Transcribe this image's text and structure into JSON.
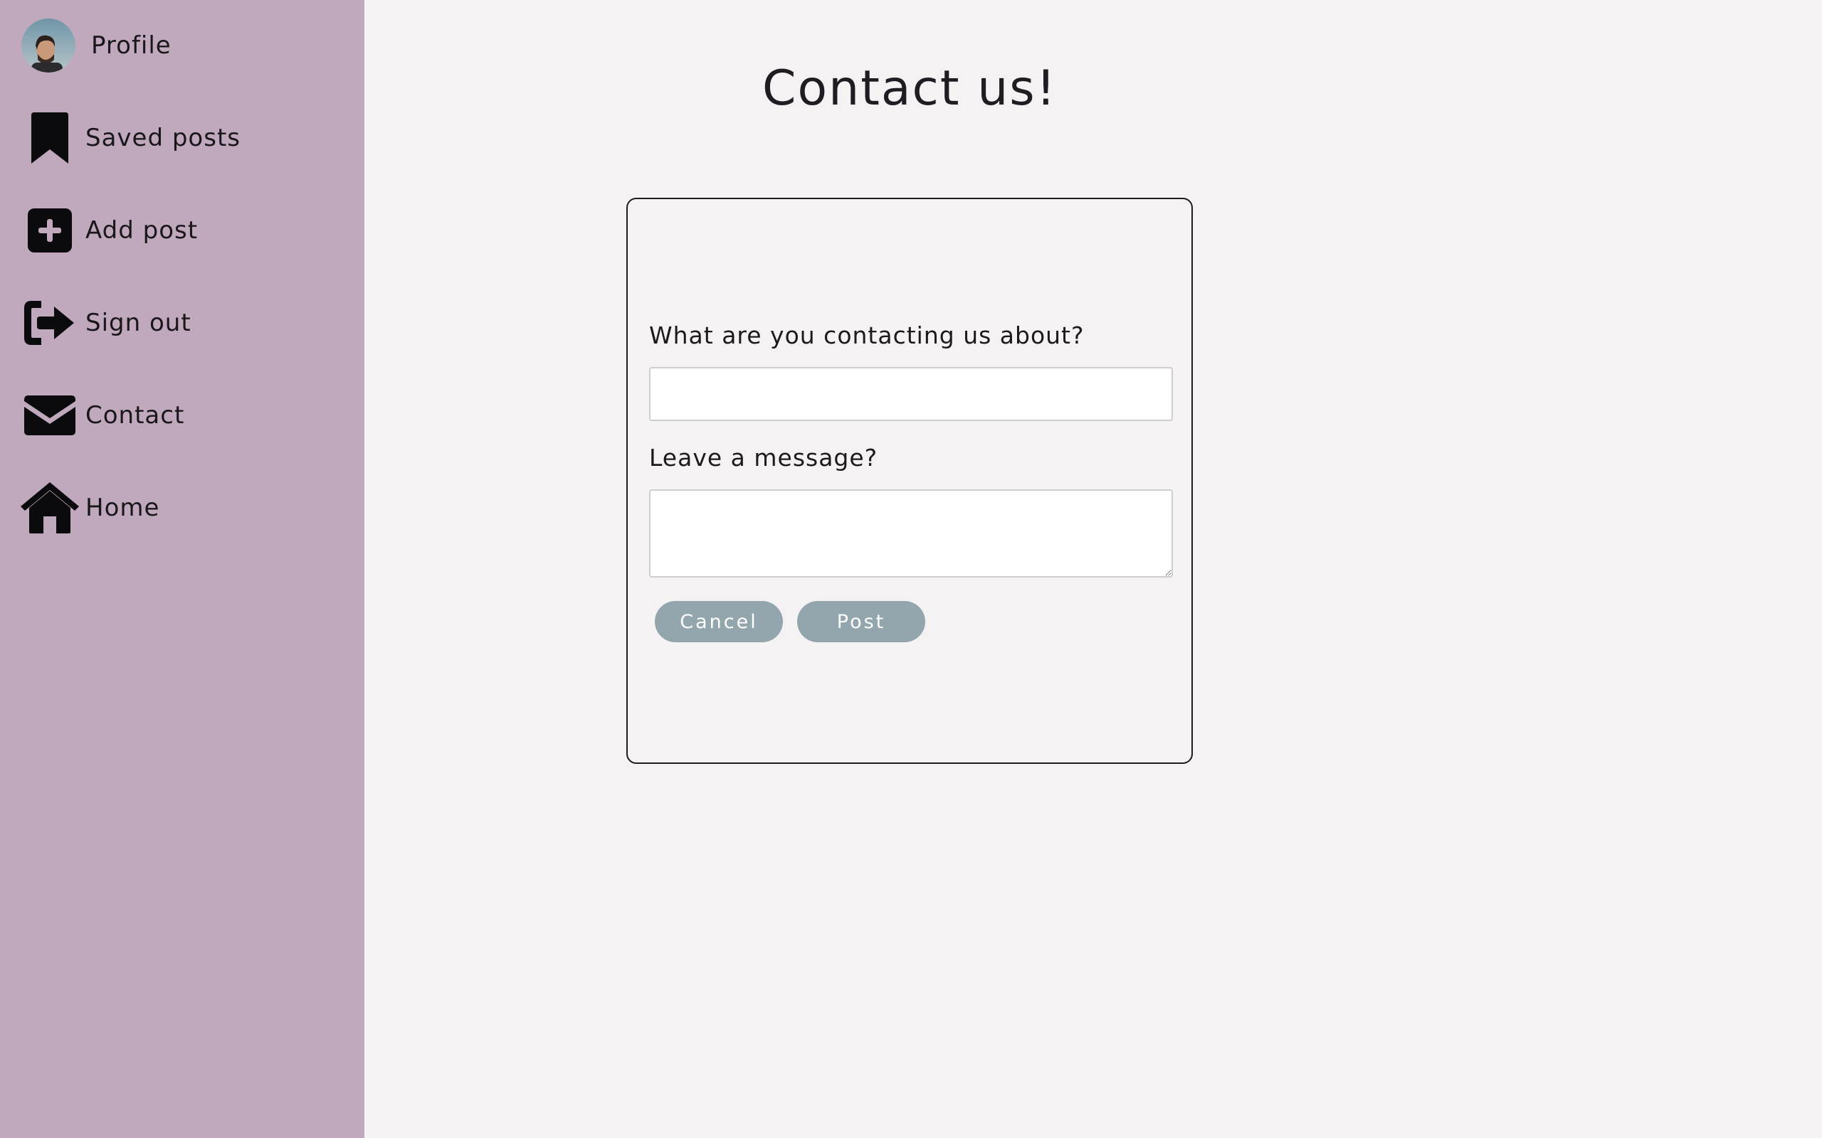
{
  "sidebar": {
    "items": [
      {
        "label": "Profile",
        "icon": "avatar"
      },
      {
        "label": "Saved posts",
        "icon": "bookmark-icon"
      },
      {
        "label": "Add post",
        "icon": "plus-square-icon"
      },
      {
        "label": "Sign out",
        "icon": "sign-out-icon"
      },
      {
        "label": "Contact",
        "icon": "envelope-icon"
      },
      {
        "label": "Home",
        "icon": "home-icon"
      }
    ]
  },
  "main": {
    "title": "Contact us!",
    "form": {
      "subject_label": "What are you contacting us about?",
      "subject_value": "",
      "message_label": "Leave a message?",
      "message_value": "",
      "cancel_label": "Cancel",
      "post_label": "Post"
    }
  },
  "colors": {
    "sidebar_bg": "#c1a9bd",
    "page_bg": "#f4f2f3",
    "button_bg": "#93a6ad"
  }
}
